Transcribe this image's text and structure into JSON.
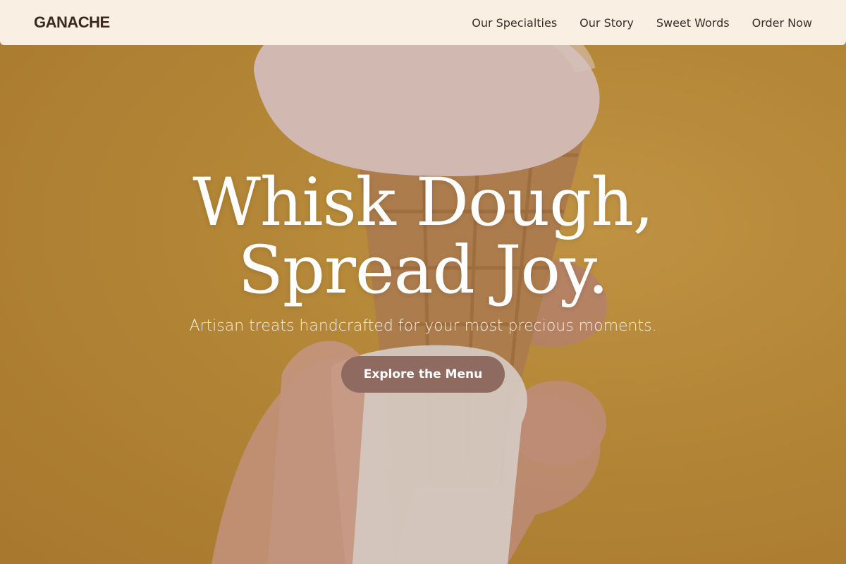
{
  "brand": {
    "name": "GANACHE"
  },
  "nav": {
    "links": [
      {
        "label": "Our Specialties"
      },
      {
        "label": "Our Story"
      },
      {
        "label": "Sweet Words"
      },
      {
        "label": "Order Now"
      }
    ]
  },
  "hero": {
    "headline_line1": "Whisk Dough,",
    "headline_line2": "Spread Joy.",
    "subtitle": "Artisan treats handcrafted for your most precious moments.",
    "cta_label": "Explore the Menu"
  },
  "colors": {
    "nav_background": "#f9efe2",
    "brand_text": "#3b2720",
    "cta_background": "#8f6a61",
    "hero_background": "#c99a3e"
  }
}
